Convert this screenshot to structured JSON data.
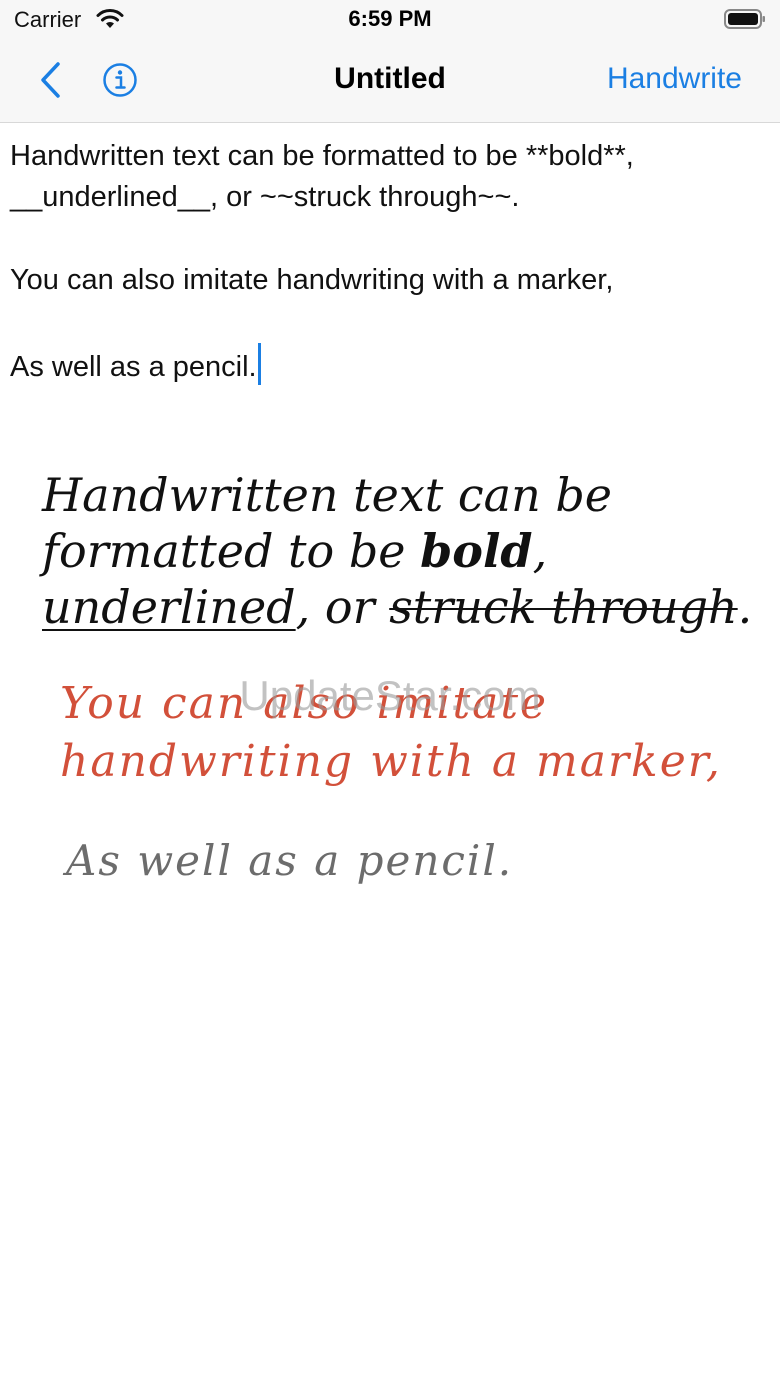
{
  "status": {
    "carrier": "Carrier",
    "time": "6:59 PM"
  },
  "nav": {
    "title": "Untitled",
    "action": "Handwrite",
    "back_icon": "chevron-left-icon",
    "info_icon": "info-circle-icon",
    "accent_color": "#1b7fe3"
  },
  "editor": {
    "line1": "Handwritten text can be formatted to be **bold**,",
    "line2": "__underlined__, or ~~struck through~~.",
    "line3": "You can also imitate handwriting with a marker,",
    "line4": "As well as a pencil."
  },
  "handwriting": {
    "l1": "Handwritten text can be",
    "l2_a": "formatted to be ",
    "l2_bold": "bold",
    "l2_b": ",",
    "l3_under": "underlined",
    "l3_a": ", or ",
    "l3_strike": "struck through",
    "l3_b": ".",
    "marker_l1": "You can also imitate",
    "marker_l2": "handwriting with a marker,",
    "pencil": "As well as a pencil.",
    "colors": {
      "pen": "#111111",
      "marker": "#d2503a",
      "pencil": "#6c6c6c"
    }
  },
  "watermark": "UpdateStar.com"
}
